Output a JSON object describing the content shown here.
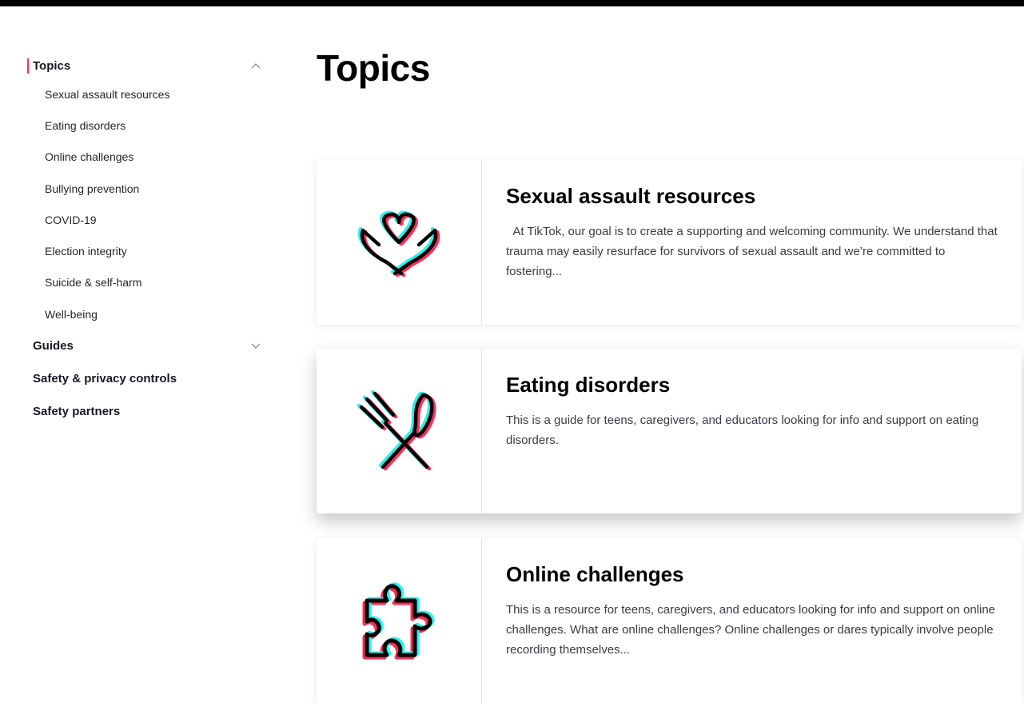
{
  "sidebar": {
    "topics_label": "Topics",
    "topics_items": [
      "Sexual assault resources",
      "Eating disorders",
      "Online challenges",
      "Bullying prevention",
      "COVID-19",
      "Election integrity",
      "Suicide & self-harm",
      "Well-being"
    ],
    "guides_label": "Guides",
    "safety_privacy_label": "Safety & privacy controls",
    "safety_partners_label": "Safety partners"
  },
  "main": {
    "title": "Topics",
    "cards": [
      {
        "title": "Sexual assault resources",
        "description": "  At TikTok, our goal is to create a supporting and welcoming community. We understand that trauma may easily resurface for survivors of sexual assault and we’re committed to fostering...",
        "icon": "hands-heart-icon"
      },
      {
        "title": "Eating disorders",
        "description": "This is a guide for teens, caregivers, and educators looking for info and support on eating disorders.",
        "icon": "fork-spoon-icon"
      },
      {
        "title": "Online challenges",
        "description": "This is a resource for teens, caregivers, and educators looking for info and support on online challenges. What are online challenges? Online challenges or dares typically involve people recording themselves...",
        "icon": "puzzle-piece-icon"
      }
    ]
  },
  "colors": {
    "accent_red": "#fe2c55",
    "accent_cyan": "#25f4ee",
    "text_primary": "#161823"
  }
}
